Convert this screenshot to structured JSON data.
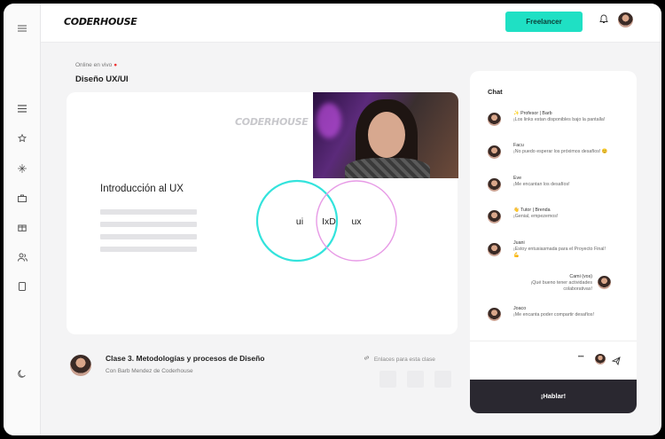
{
  "brand": {
    "logo_text": "CODERHOUSE"
  },
  "topbar": {
    "freelancer_label": "Freelancer"
  },
  "sidebar": {
    "icons": [
      "menu-icon",
      "list-icon",
      "star-icon",
      "sparkle-icon",
      "briefcase-icon",
      "gift-icon",
      "users-icon",
      "tablet-icon",
      "moon-icon"
    ]
  },
  "page": {
    "status": "Online en vivo",
    "title": "Diseño UX/UI"
  },
  "slide": {
    "logo_text": "CODERHOUSE",
    "title": "Introducción al UX",
    "venn": {
      "left": "ui",
      "center": "IxD",
      "right": "ux"
    }
  },
  "class_info": {
    "title": "Clase 3. Metodologías y procesos de Diseño",
    "subtitle": "Con Barb Mendez de Coderhouse",
    "links_label": "Enlaces para esta clase"
  },
  "chat": {
    "header": "Chat",
    "messages": [
      {
        "name": "✨ Profesor | Barb",
        "text": "¡Los links estan disponibles bajo la pantalla!",
        "side": "left"
      },
      {
        "name": "Facu",
        "text": "¡No puedo esperar los próximos desafíos! 😊",
        "side": "left"
      },
      {
        "name": "Eve",
        "text": "¡Me encantan los desafíos!",
        "side": "left"
      },
      {
        "name": "👋 Tutor | Brenda",
        "text": "¡Genial, empezemos!",
        "side": "left"
      },
      {
        "name": "Juani",
        "text": "¡Estoy entusiasmada para el Proyecto Final! 💪",
        "side": "left"
      },
      {
        "name": "Cami (vos)",
        "text": "¡Qué bueno tener actividades colaborativas!",
        "side": "right"
      },
      {
        "name": "Joaco",
        "text": "¡Me encanta poder compartir desafíos!",
        "side": "left"
      }
    ],
    "input_dots": "•••",
    "send_label": "¡Hablar!"
  },
  "colors": {
    "accent": "#1fe0c4",
    "circle_teal": "#33e3dc",
    "circle_pink": "#e79be6",
    "dark": "#2a2830"
  }
}
